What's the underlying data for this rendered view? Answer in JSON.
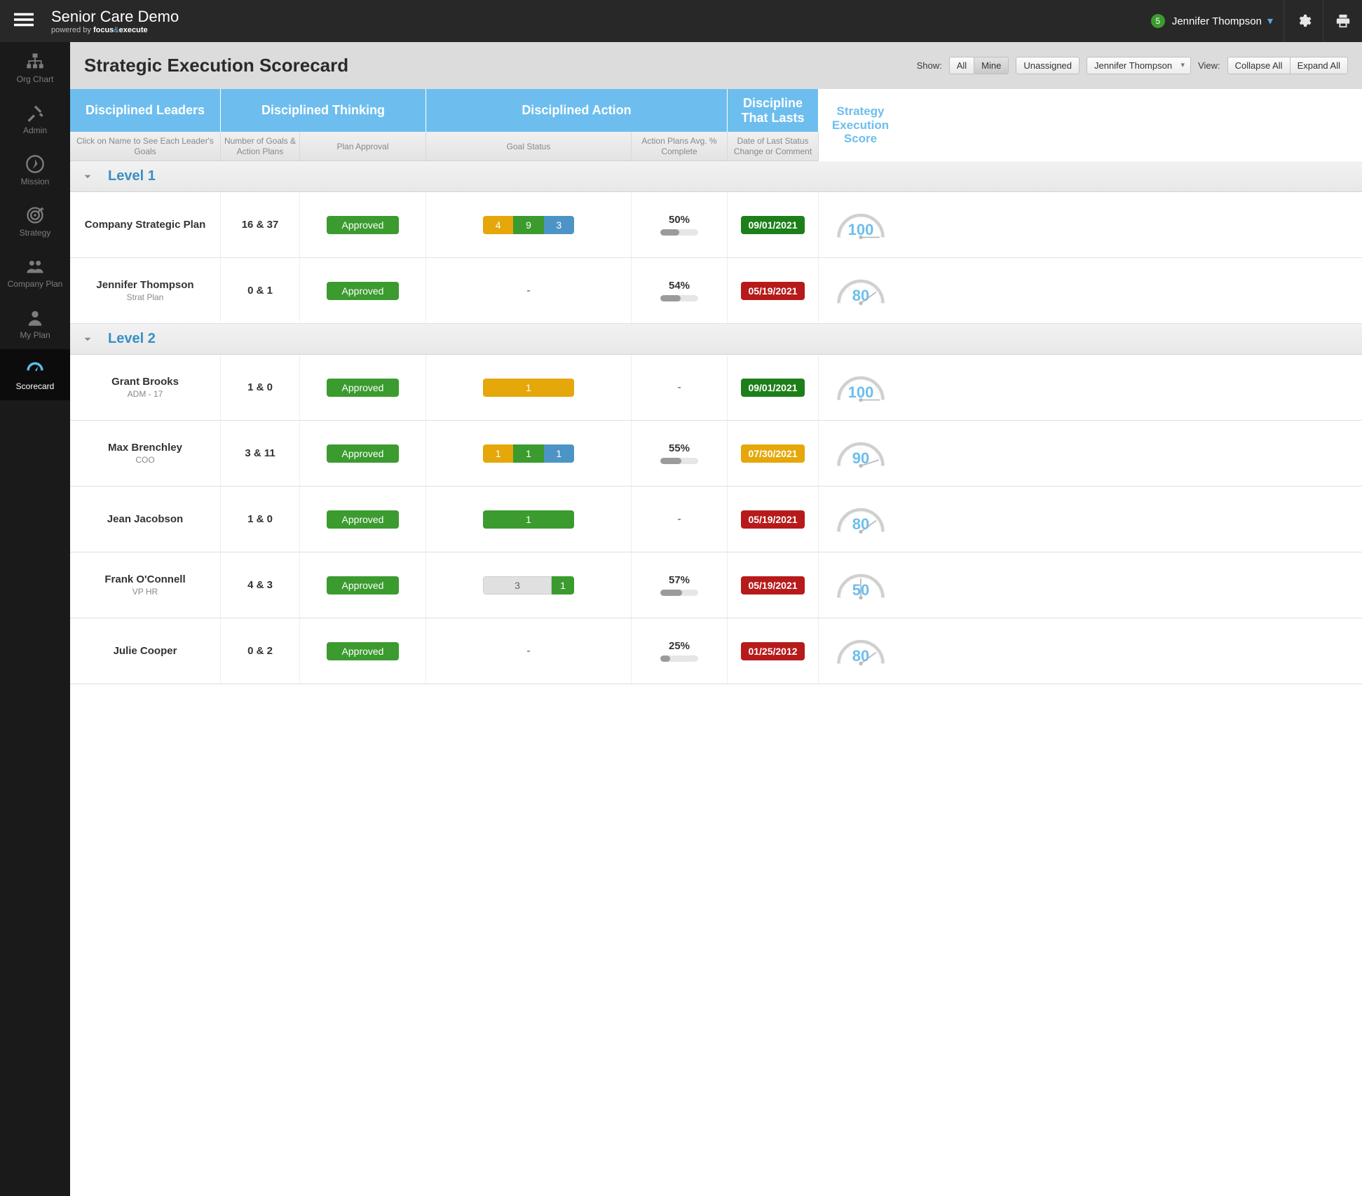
{
  "brand": {
    "title": "Senior Care Demo",
    "powered_prefix": "powered by ",
    "powered_bold1": "focus",
    "powered_amp": "&",
    "powered_bold2": "execute"
  },
  "user": {
    "count": "5",
    "name": "Jennifer Thompson"
  },
  "sidebar": {
    "items": [
      {
        "label": "Org Chart"
      },
      {
        "label": "Admin"
      },
      {
        "label": "Mission"
      },
      {
        "label": "Strategy"
      },
      {
        "label": "Company Plan"
      },
      {
        "label": "My Plan"
      },
      {
        "label": "Scorecard"
      }
    ]
  },
  "toolbar": {
    "title": "Strategic Execution Scorecard",
    "show_label": "Show:",
    "btn_all": "All",
    "btn_mine": "Mine",
    "btn_unassigned": "Unassigned",
    "person_selected": "Jennifer Thompson",
    "view_label": "View:",
    "btn_collapse": "Collapse All",
    "btn_expand": "Expand All"
  },
  "columns": {
    "group1": "Disciplined Leaders",
    "group2": "Disciplined Thinking",
    "group3": "Disciplined Action",
    "group4": "Discipline That Lasts",
    "group5": "Strategy Execution Score",
    "sub1": "Click on Name to See Each Leader's Goals",
    "sub2": "Number of Goals & Action Plans",
    "sub3": "Plan Approval",
    "sub4": "Goal Status",
    "sub5": "Action Plans Avg. % Complete",
    "sub6": "Date of Last Status Change or Comment"
  },
  "levels": [
    {
      "label": "Level 1",
      "rows": [
        {
          "name": "Company Strategic Plan",
          "role": "",
          "goals": "16 & 37",
          "approval": "Approved",
          "status": [
            {
              "c": "yellow",
              "v": "4"
            },
            {
              "c": "green",
              "v": "9"
            },
            {
              "c": "blue",
              "v": "3"
            }
          ],
          "pct": "50%",
          "pct_w": 50,
          "date": "09/01/2021",
          "date_c": "g",
          "score": "100"
        },
        {
          "name": "Jennifer Thompson",
          "role": "Strat Plan",
          "goals": "0 & 1",
          "approval": "Approved",
          "status_dash": true,
          "pct": "54%",
          "pct_w": 54,
          "date": "05/19/2021",
          "date_c": "r",
          "score": "80"
        }
      ]
    },
    {
      "label": "Level 2",
      "rows": [
        {
          "name": "Grant Brooks",
          "role": "ADM - 17",
          "goals": "1 & 0",
          "approval": "Approved",
          "status": [
            {
              "c": "yellow",
              "v": "1",
              "full": true
            }
          ],
          "pct_dash": true,
          "date": "09/01/2021",
          "date_c": "g",
          "score": "100"
        },
        {
          "name": "Max Brenchley",
          "role": "COO",
          "goals": "3 & 11",
          "approval": "Approved",
          "status": [
            {
              "c": "yellow",
              "v": "1"
            },
            {
              "c": "green",
              "v": "1"
            },
            {
              "c": "blue",
              "v": "1"
            }
          ],
          "pct": "55%",
          "pct_w": 55,
          "date": "07/30/2021",
          "date_c": "y",
          "score": "90"
        },
        {
          "name": "Jean Jacobson",
          "role": "",
          "goals": "1 & 0",
          "approval": "Approved",
          "status": [
            {
              "c": "green",
              "v": "1",
              "full": true
            }
          ],
          "pct_dash": true,
          "date": "05/19/2021",
          "date_c": "r",
          "score": "80"
        },
        {
          "name": "Frank O'Connell",
          "role": "VP HR",
          "goals": "4 & 3",
          "approval": "Approved",
          "status": [
            {
              "c": "gray",
              "v": "3",
              "w": 3
            },
            {
              "c": "green",
              "v": "1",
              "w": 1
            }
          ],
          "pct": "57%",
          "pct_w": 57,
          "date": "05/19/2021",
          "date_c": "r",
          "score": "50"
        },
        {
          "name": "Julie Cooper",
          "role": "",
          "goals": "0 & 2",
          "approval": "Approved",
          "status_dash": true,
          "pct": "25%",
          "pct_w": 25,
          "date": "01/25/2012",
          "date_c": "r",
          "score": "80"
        }
      ]
    }
  ]
}
